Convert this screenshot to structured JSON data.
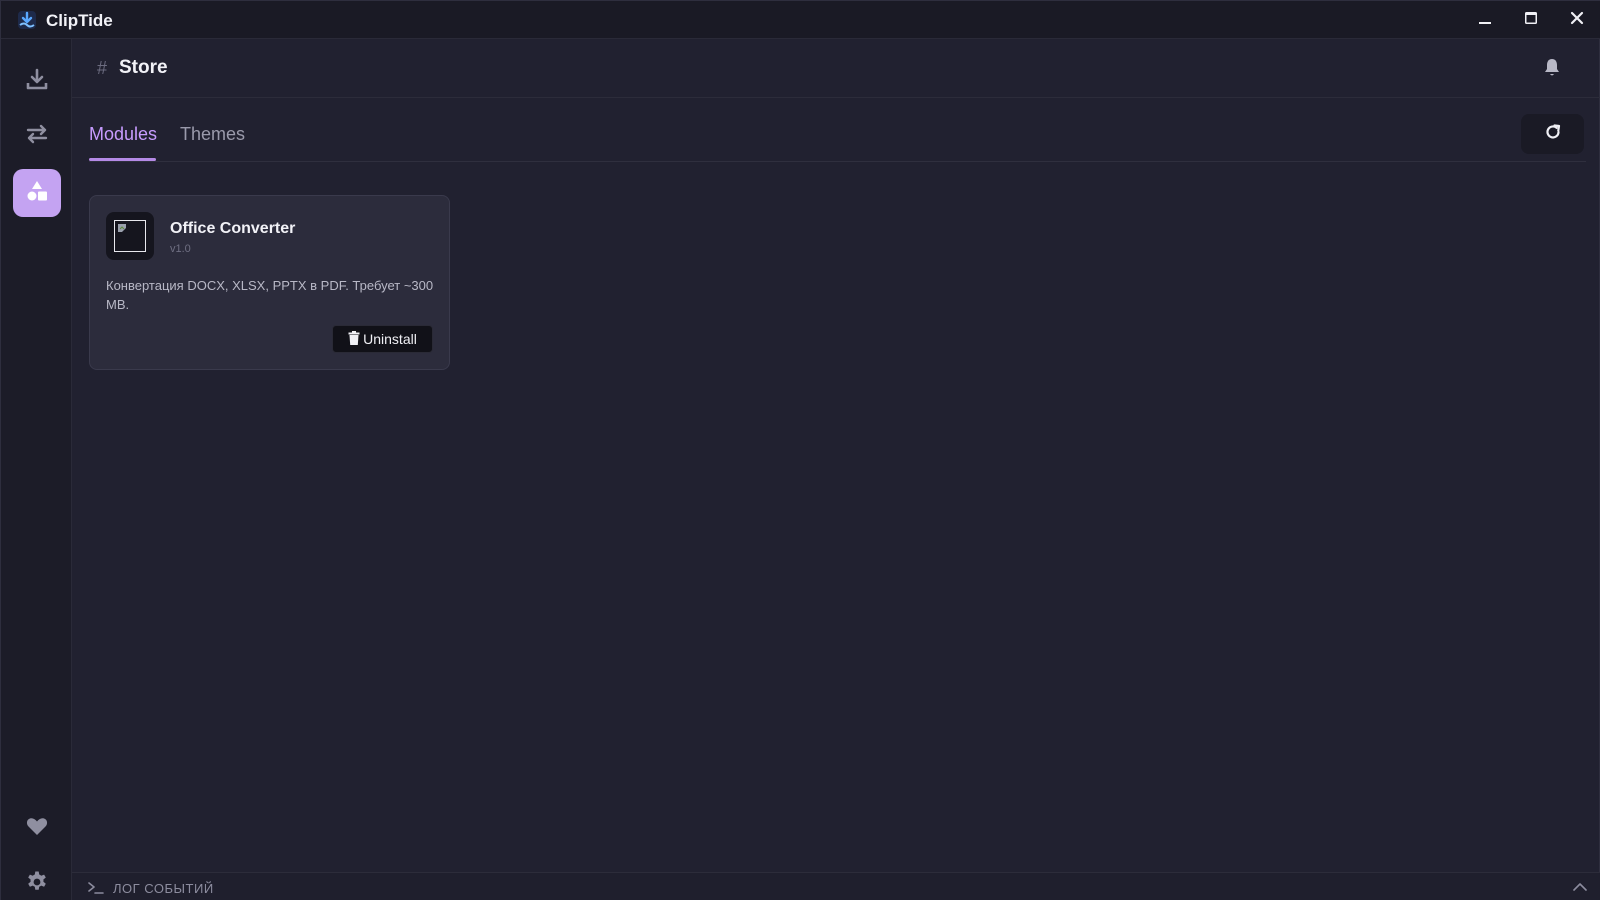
{
  "app": {
    "title": "ClipTide"
  },
  "header": {
    "hash": "#",
    "title": "Store"
  },
  "tabs": [
    {
      "label": "Modules",
      "active": true
    },
    {
      "label": "Themes",
      "active": false
    }
  ],
  "modules": [
    {
      "name": "Office Converter",
      "version": "v1.0",
      "description": "Конвертация DOCX, XLSX, PPTX в PDF. Требует ~300 MB.",
      "action_label": "Uninstall",
      "action_icon": "trash-icon"
    }
  ],
  "log": {
    "label": "ЛОГ СОБЫТИЙ"
  },
  "colors": {
    "accent": "#c79cff",
    "active_sidebar": "#c4a3f2",
    "background": "#212130",
    "sidebar": "#1c1c28",
    "card": "#2c2c3c"
  },
  "icons": {
    "sidebar": [
      "download-icon",
      "convert-icon",
      "store-icon",
      "heart-icon",
      "gear-icon"
    ],
    "header": [
      "bell-icon"
    ],
    "window": [
      "minimize-icon",
      "maximize-icon",
      "close-icon"
    ],
    "toolbar": [
      "refresh-icon"
    ],
    "log": [
      "terminal-icon",
      "chevron-up-icon"
    ]
  }
}
